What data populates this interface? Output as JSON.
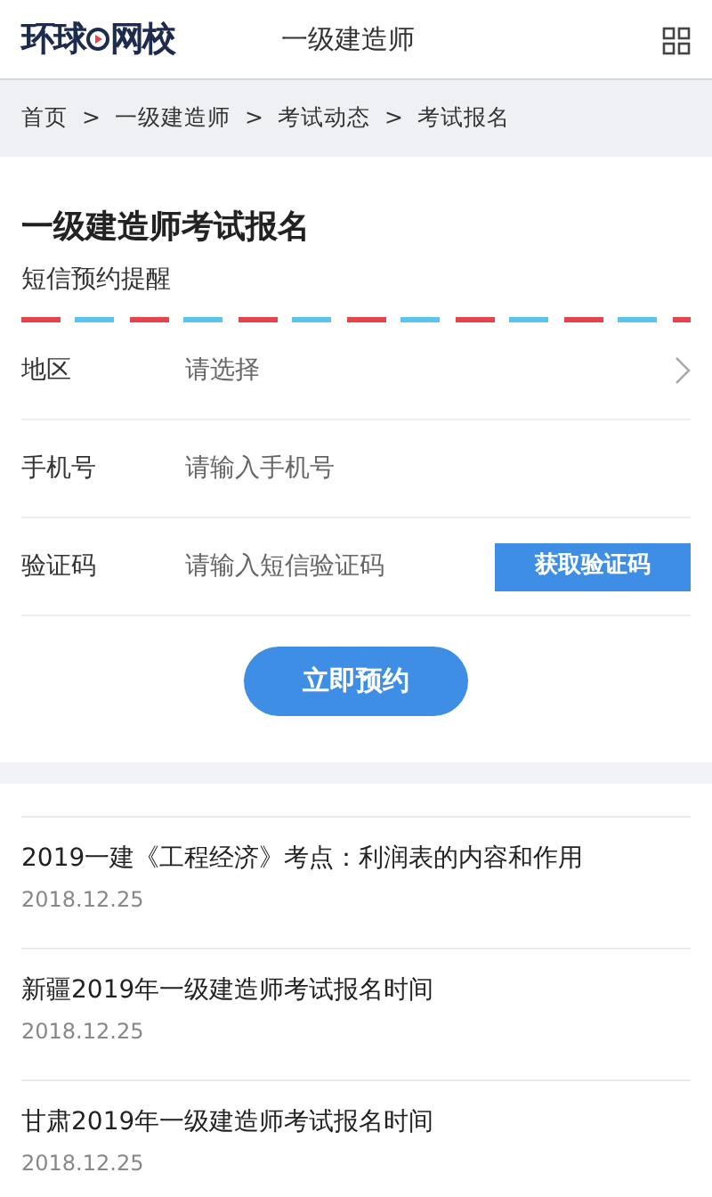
{
  "header": {
    "logo_left": "环球",
    "logo_right": "网校",
    "title": "一级建造师"
  },
  "breadcrumb": [
    {
      "label": "首页"
    },
    {
      "label": "一级建造师"
    },
    {
      "label": "考试动态"
    },
    {
      "label": "考试报名"
    }
  ],
  "breadcrumb_separator": ">",
  "form": {
    "title": "一级建造师考试报名",
    "subtitle": "短信预约提醒",
    "fields": [
      {
        "kind": "select",
        "label": "地区",
        "placeholder": "请选择"
      },
      {
        "kind": "input",
        "label": "手机号",
        "placeholder": "请输入手机号"
      },
      {
        "kind": "code",
        "label": "验证码",
        "placeholder": "请输入短信验证码",
        "button": "获取验证码"
      }
    ],
    "submit": "立即预约"
  },
  "news": [
    {
      "title": "2019一建《工程经济》考点：利润表的内容和作用",
      "date": "2018.12.25"
    },
    {
      "title": "新疆2019年一级建造师考试报名时间",
      "date": "2018.12.25"
    },
    {
      "title": "甘肃2019年一级建造师考试报名时间",
      "date": "2018.12.25"
    }
  ]
}
